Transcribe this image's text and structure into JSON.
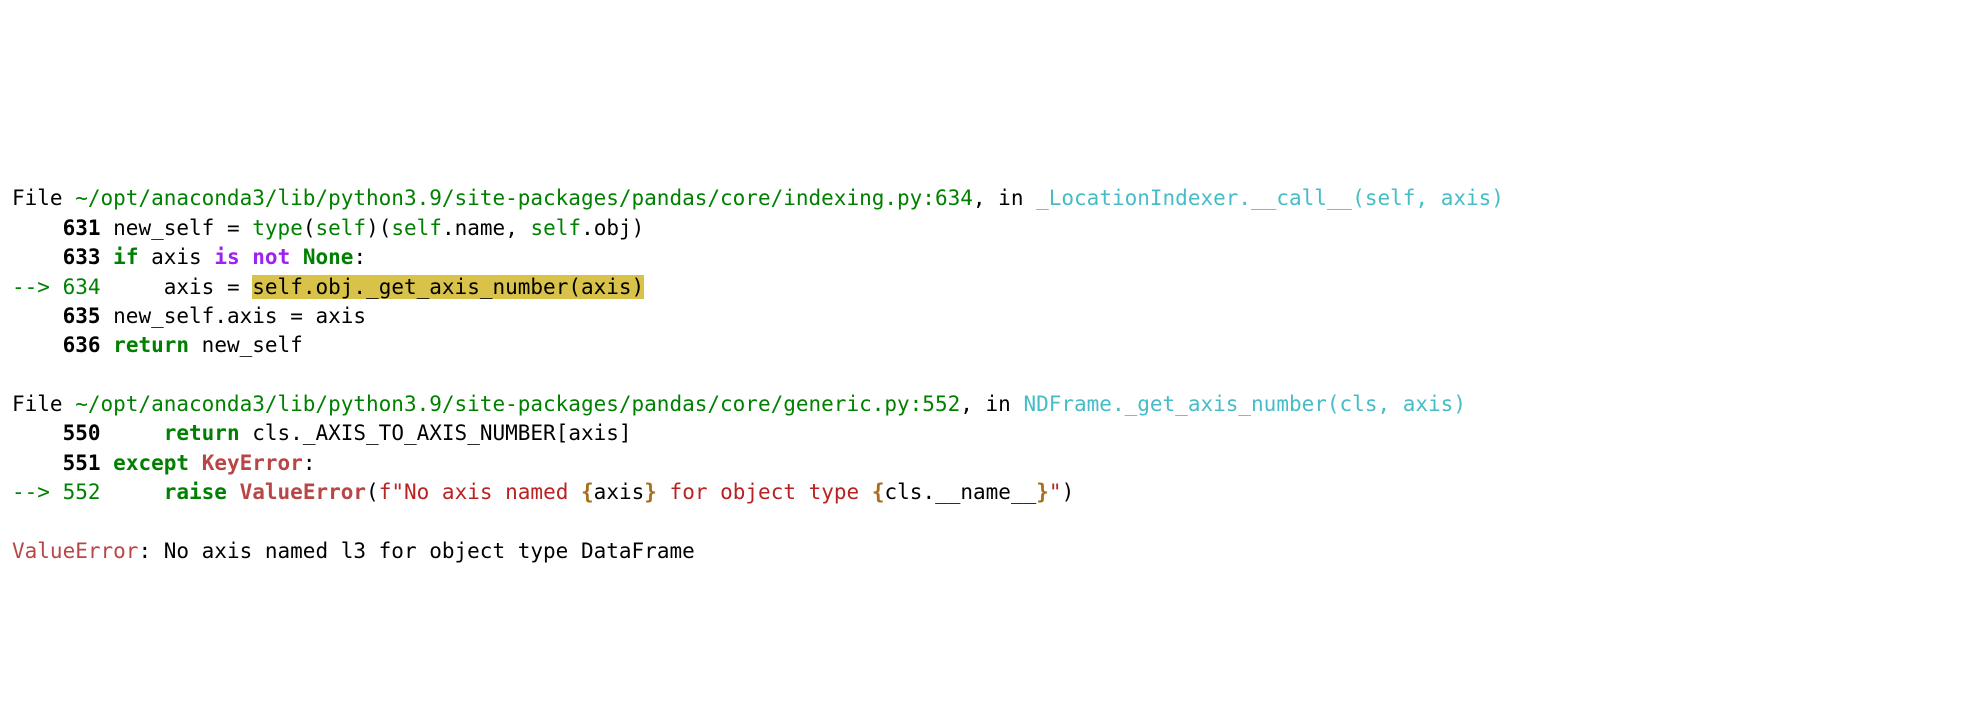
{
  "frame1": {
    "file_label": "File ",
    "path": "~/opt/anaconda3/lib/python3.9/site-packages/pandas/core/indexing.py:634",
    "in": ", in ",
    "func": "_LocationIndexer.__call__(self, axis)",
    "lines": {
      "l631_no": "631",
      "l631_a": " new_self ",
      "l631_eq": "=",
      "l631_b": " ",
      "l631_type": "type",
      "l631_c": "(",
      "l631_self1": "self",
      "l631_d": ")(",
      "l631_self2": "self",
      "l631_e": ".",
      "l631_name": "name",
      "l631_f": ", ",
      "l631_self3": "self",
      "l631_g": ".",
      "l631_obj": "obj",
      "l631_h": ")",
      "l633_no": "633",
      "l633_if": "if",
      "l633_axis": " axis ",
      "l633_is": "is",
      "l633_sp": " ",
      "l633_not": "not",
      "l633_sp2": " ",
      "l633_none": "None",
      "l633_colon": ":",
      "arrow": "--> ",
      "l634_no": "634",
      "l634_a": "     axis ",
      "l634_eq": "=",
      "l634_sp": " ",
      "l634_hl": "self.obj._get_axis_number(axis)",
      "l635_no": "635",
      "l635_a": " new_self",
      "l635_b": ".",
      "l635_c": "axis ",
      "l635_eq": "=",
      "l635_d": " axis",
      "l636_no": "636",
      "l636_ret": "return",
      "l636_a": " new_self"
    }
  },
  "frame2": {
    "file_label": "File ",
    "path": "~/opt/anaconda3/lib/python3.9/site-packages/pandas/core/generic.py:552",
    "in": ", in ",
    "func": "NDFrame._get_axis_number(cls, axis)",
    "lines": {
      "l550_no": "550",
      "l550_ret": "return",
      "l550_a": " cls",
      "l550_b": ".",
      "l550_c": "_AXIS_TO_AXIS_NUMBER[axis]",
      "l551_no": "551",
      "l551_except": "except",
      "l551_sp": " ",
      "l551_keyerr": "KeyError",
      "l551_colon": ":",
      "arrow": "--> ",
      "l552_no": "552",
      "l552_sp": "     ",
      "l552_raise": "raise",
      "l552_sp2": " ",
      "l552_valerr": "ValueError",
      "l552_paren": "(",
      "l552_f": "f\"",
      "l552_s1": "No axis named ",
      "l552_i1a": "{",
      "l552_i1b": "axis",
      "l552_i1c": "}",
      "l552_s2": " for object type ",
      "l552_i2a": "{",
      "l552_i2b": "cls",
      "l552_i2c": ".",
      "l552_i2d": "__name__",
      "l552_i2e": "}",
      "l552_s3": "\"",
      "l552_paren2": ")"
    }
  },
  "error": {
    "name": "ValueError",
    "sep": ": ",
    "msg": "No axis named l3 for object type DataFrame"
  }
}
